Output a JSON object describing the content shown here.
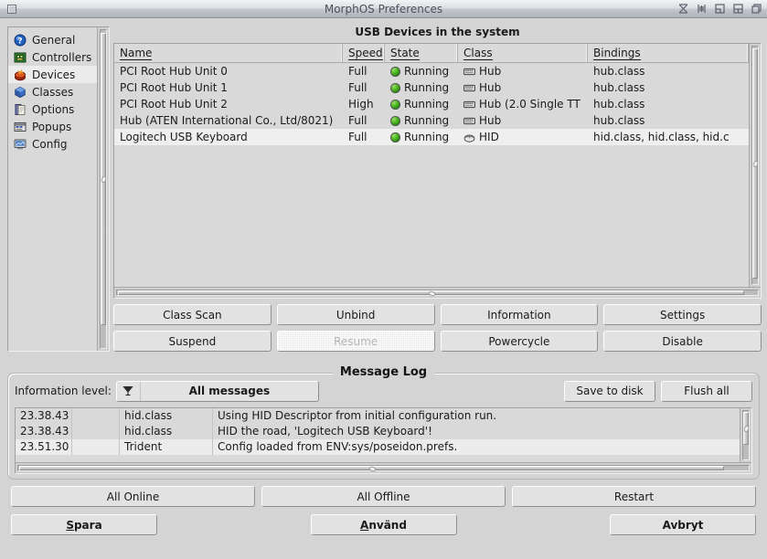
{
  "window": {
    "title": "MorphOS Preferences",
    "close_gadget": "close-icon",
    "right_gadgets": [
      "snapshot-icon",
      "iconify-icon",
      "shrink-icon",
      "zoom-icon",
      "depth-icon"
    ]
  },
  "sidebar": {
    "items": [
      {
        "label": "General",
        "icon": "question-ball-icon",
        "selected": false
      },
      {
        "label": "Controllers",
        "icon": "chip-board-icon",
        "selected": false
      },
      {
        "label": "Devices",
        "icon": "usb-device-icon",
        "selected": true
      },
      {
        "label": "Classes",
        "icon": "blue-cube-icon",
        "selected": false
      },
      {
        "label": "Options",
        "icon": "document-icon",
        "selected": false
      },
      {
        "label": "Popups",
        "icon": "popup-window-icon",
        "selected": false
      },
      {
        "label": "Config",
        "icon": "config-screen-icon",
        "selected": false
      }
    ]
  },
  "devices": {
    "caption": "USB Devices in the system",
    "columns": [
      "Name",
      "Speed",
      "State",
      "Class",
      "Bindings"
    ],
    "rows": [
      {
        "name": "PCI Root Hub Unit 0",
        "speed": "Full",
        "state": "Running",
        "class": "Hub",
        "class_icon": "hub-icon",
        "bindings": "hub.class",
        "selected": false
      },
      {
        "name": "PCI Root Hub Unit 1",
        "speed": "Full",
        "state": "Running",
        "class": "Hub",
        "class_icon": "hub-icon",
        "bindings": "hub.class",
        "selected": false
      },
      {
        "name": "PCI Root Hub Unit 2",
        "speed": "High",
        "state": "Running",
        "class": "Hub (2.0 Single TT",
        "class_icon": "hub-icon",
        "bindings": "hub.class",
        "selected": false
      },
      {
        "name": "Hub (ATEN International Co., Ltd/8021)",
        "speed": "Full",
        "state": "Running",
        "class": "Hub",
        "class_icon": "hub-icon",
        "bindings": "hub.class",
        "selected": false
      },
      {
        "name": "Logitech USB Keyboard",
        "speed": "Full",
        "state": "Running",
        "class": "HID",
        "class_icon": "hid-icon",
        "bindings": "hid.class, hid.class, hid.c",
        "selected": true
      }
    ]
  },
  "device_buttons": [
    {
      "label": "Class Scan",
      "disabled": false
    },
    {
      "label": "Unbind",
      "disabled": false
    },
    {
      "label": "Information",
      "disabled": false
    },
    {
      "label": "Settings",
      "disabled": false
    },
    {
      "label": "Suspend",
      "disabled": false
    },
    {
      "label": "Resume",
      "disabled": true
    },
    {
      "label": "Powercycle",
      "disabled": false
    },
    {
      "label": "Disable",
      "disabled": false
    }
  ],
  "message_log": {
    "legend": "Message Log",
    "info_level_label": "Information level:",
    "info_level_value": "All messages",
    "cycle_icon": "cycle-gadget-icon",
    "save_label": "Save to disk",
    "flush_label": "Flush all",
    "entries": [
      {
        "time": "23.38.43",
        "blank": "",
        "source": "hid.class",
        "message": "Using HID Descriptor from initial configuration run.",
        "alt": false
      },
      {
        "time": "23.38.43",
        "blank": "",
        "source": "hid.class",
        "message": "HID the road, 'Logitech USB Keyboard'!",
        "alt": false
      },
      {
        "time": "23.51.30",
        "blank": "",
        "source": "Trident",
        "message": "Config loaded from ENV:sys/poseidon.prefs.",
        "alt": true
      }
    ]
  },
  "bottom": {
    "row1": [
      "All Online",
      "All Offline",
      "Restart"
    ],
    "save": {
      "pre": "S",
      "key": "",
      "post": "para",
      "full": "Spara"
    },
    "apply": {
      "pre": "A",
      "post": "nvänd",
      "full": "Använd"
    },
    "cancel": {
      "full": "Avbryt"
    }
  },
  "colors": {
    "background": "#d4d4d4",
    "titlebar_text": "#4b4f57",
    "led_green": "#4cb820",
    "selection": "#efefef"
  }
}
